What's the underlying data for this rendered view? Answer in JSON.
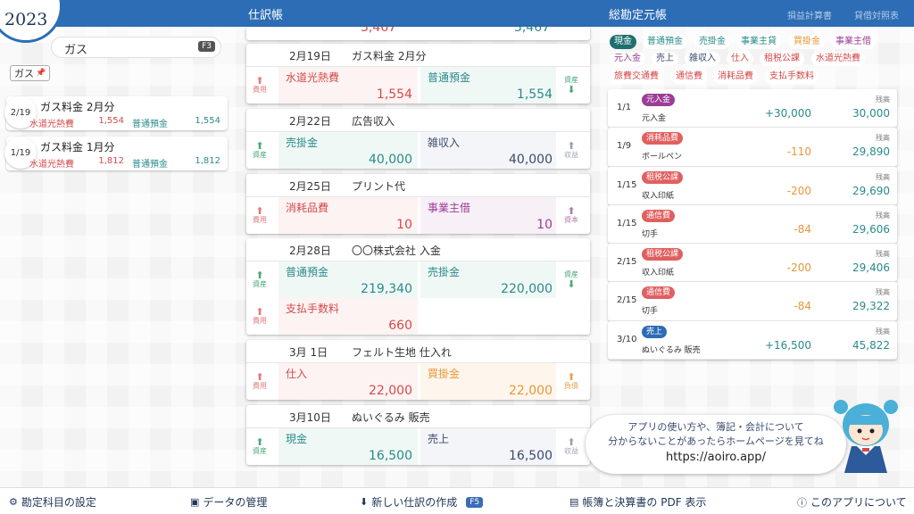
{
  "header": {
    "year": "2023",
    "journal_title": "仕訳帳",
    "ledger_title": "総勘定元帳",
    "link_pl": "損益計算書",
    "link_bs": "貸借対照表"
  },
  "search": {
    "value": "ガス",
    "shortcut": "F3",
    "filter_chip": "ガス"
  },
  "search_results": [
    {
      "date": "2/19",
      "title": "ガス料金 2月分",
      "debit": "水道光熱費",
      "debit_amount": "1,554",
      "credit": "普通預金",
      "credit_amount": "1,554"
    },
    {
      "date": "1/19",
      "title": "ガス料金 1月分",
      "debit": "水道光熱費",
      "debit_amount": "1,812",
      "credit": "普通預金",
      "credit_amount": "1,812"
    }
  ],
  "journal": {
    "top_partial": {
      "left": "3,467",
      "right": "3,467"
    },
    "entries": [
      {
        "date": "2月19日",
        "desc": "ガス料金 2月分",
        "rows": [
          {
            "left_tag": "費用",
            "right_tag": "資産",
            "debit": "水道光熱費",
            "debit_amount": "1,554",
            "credit": "普通預金",
            "credit_amount": "1,554"
          }
        ]
      },
      {
        "date": "2月22日",
        "desc": "広告収入",
        "rows": [
          {
            "left_tag": "資産",
            "right_tag": "収益",
            "debit": "売掛金",
            "debit_amount": "40,000",
            "credit": "雑収入",
            "credit_amount": "40,000"
          }
        ]
      },
      {
        "date": "2月25日",
        "desc": "プリント代",
        "rows": [
          {
            "left_tag": "費用",
            "right_tag": "資本",
            "debit": "消耗品費",
            "debit_amount": "10",
            "credit": "事業主借",
            "credit_amount": "10"
          }
        ]
      },
      {
        "date": "2月28日",
        "desc": "〇〇株式会社 入金",
        "rows": [
          {
            "left_tag": "資産",
            "right_tag": "資産",
            "debit": "普通預金",
            "debit_amount": "219,340",
            "credit": "売掛金",
            "credit_amount": "220,000"
          },
          {
            "left_tag": "費用",
            "debit": "支払手数料",
            "debit_amount": "660"
          }
        ]
      },
      {
        "date": "3月 1日",
        "desc": "フェルト生地 仕入れ",
        "rows": [
          {
            "left_tag": "費用",
            "right_tag": "負債",
            "debit": "仕入",
            "debit_amount": "22,000",
            "credit": "買掛金",
            "credit_amount": "22,000"
          }
        ]
      },
      {
        "date": "3月10日",
        "desc": "ぬいぐるみ 販売",
        "rows": [
          {
            "left_tag": "資産",
            "right_tag": "収益",
            "debit": "現金",
            "debit_amount": "16,500",
            "credit": "売上",
            "credit_amount": "16,500"
          }
        ]
      }
    ]
  },
  "accounts": [
    "現金",
    "普通預金",
    "売掛金",
    "事業主貸",
    "買掛金",
    "事業主借",
    "元入金",
    "売上",
    "雑収入",
    "仕入",
    "租税公課",
    "水道光熱費",
    "旅費交通費",
    "通信費",
    "消耗品費",
    "支払手数料"
  ],
  "ledger": {
    "balance_label": "残高",
    "rows": [
      {
        "date": "1/1",
        "badge": "元入金",
        "desc": "元入金",
        "amount": "+30,000",
        "balance": "30,000"
      },
      {
        "date": "1/9",
        "badge": "消耗品費",
        "desc": "ボールペン",
        "amount": "-110",
        "balance": "29,890"
      },
      {
        "date": "1/15",
        "badge": "租税公課",
        "desc": "収入印紙",
        "amount": "-200",
        "balance": "29,690"
      },
      {
        "date": "1/15",
        "badge": "通信費",
        "desc": "切手",
        "amount": "-84",
        "balance": "29,606"
      },
      {
        "date": "2/15",
        "badge": "租税公課",
        "desc": "収入印紙",
        "amount": "-200",
        "balance": "29,406"
      },
      {
        "date": "2/15",
        "badge": "通信費",
        "desc": "切手",
        "amount": "-84",
        "balance": "29,322"
      },
      {
        "date": "3/10",
        "badge": "売上",
        "desc": "ぬいぐるみ 販売",
        "amount": "+16,500",
        "balance": "45,822"
      }
    ]
  },
  "help": {
    "line1": "アプリの使い方や、簿記・会計について",
    "line2": "分からないことがあったらホームページを見てね",
    "url": "https://aoiro.app/"
  },
  "footer": {
    "accounts_settings": "勘定科目の設定",
    "data_management": "データの管理",
    "new_entry": "新しい仕訳の作成",
    "new_entry_key": "F5",
    "pdf": "帳簿と決算書の PDF 表示",
    "about": "このアプリについて"
  },
  "colors": {
    "brand": "#2c6db5",
    "asset": "#2a8a8a",
    "expense": "#d64a4a",
    "liability": "#e8963a",
    "capital": "#9b3d96"
  }
}
